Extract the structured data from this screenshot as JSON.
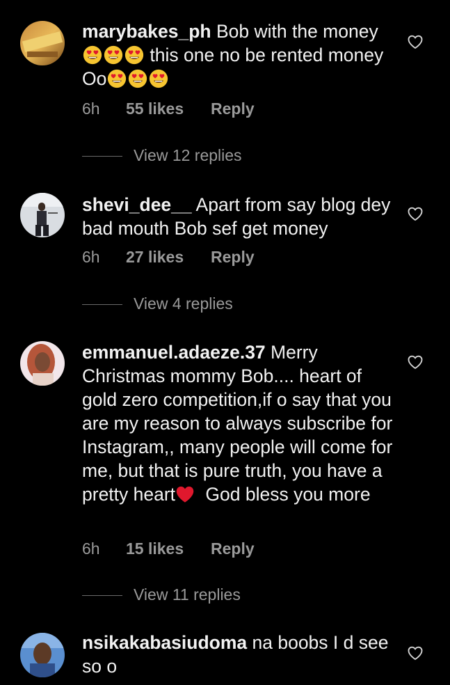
{
  "comments": [
    {
      "username": "marybakes_ph",
      "text_1": " Bob with the money ",
      "text_2": " this one no be rented money Oo",
      "time": "6h",
      "likes": "55 likes",
      "reply": "Reply",
      "view_replies": "View 12 replies"
    },
    {
      "username": "shevi_dee__",
      "text": " Apart from say blog dey bad mouth Bob sef get money",
      "time": "6h",
      "likes": "27 likes",
      "reply": "Reply",
      "view_replies": "View 4 replies"
    },
    {
      "username": "emmanuel.adaeze.37",
      "text_1": " Merry Christmas mommy Bob.... heart of gold zero competition,if  o say that you are my reason to always subscribe for Instagram,, many people will come for me, but that is pure truth, you have a pretty heart",
      "text_2": " God bless you more",
      "time": "6h",
      "likes": "15 likes",
      "reply": "Reply",
      "view_replies": "View 11 replies"
    },
    {
      "username": "nsikakabasiudoma",
      "text": " na boobs I d see so o"
    }
  ],
  "icons": {
    "like": "heart-outline-icon",
    "emoji": "heart-eyes-emoji",
    "red_heart": "red-heart-emoji"
  },
  "colors": {
    "background": "#000000",
    "text": "#f2f2f2",
    "secondary": "#9a9a9a",
    "emoji_face": "#f7c531",
    "red_heart": "#e0182d"
  }
}
